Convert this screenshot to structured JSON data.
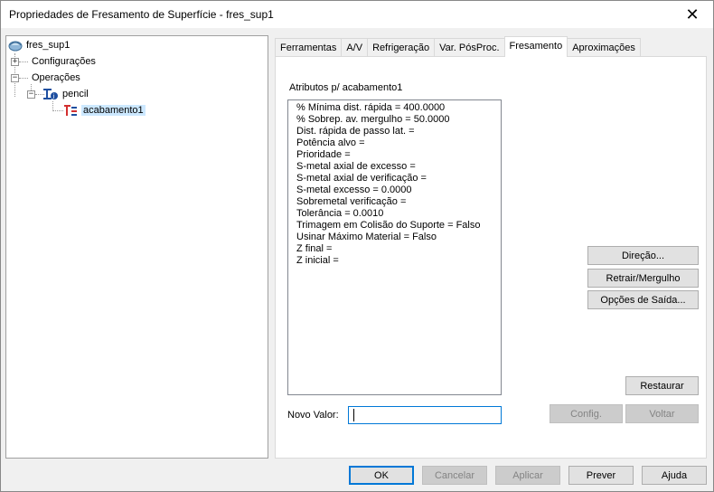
{
  "window": {
    "title": "Propriedades de Fresamento de Superfície - fres_sup1",
    "close_glyph": "✕"
  },
  "tree": {
    "root": "fres_sup1",
    "items": [
      {
        "label": "Configurações",
        "expander": "+"
      },
      {
        "label": "Operações",
        "expander": "−"
      },
      {
        "label": "pencil",
        "expander": "−"
      },
      {
        "label": "acabamento1"
      }
    ]
  },
  "tabs": [
    {
      "label": "Ferramentas"
    },
    {
      "label": "A/V"
    },
    {
      "label": "Refrigeração"
    },
    {
      "label": "Var. PósProc."
    },
    {
      "label": "Fresamento",
      "active": true
    },
    {
      "label": "Aproximações"
    }
  ],
  "attributes": {
    "header": "Atributos p/   acabamento1",
    "items": [
      "% Mínima dist. rápida = 400.0000",
      "% Sobrep. av. mergulho = 50.0000",
      "Dist. rápida de passo lat. =",
      "Potência alvo =",
      "Prioridade =",
      "S-metal axial de excesso =",
      "S-metal axial de verificação =",
      "S-metal excesso = 0.0000",
      "Sobremetal verificação =",
      "Tolerância = 0.0010",
      "Trimagem em Colisão do Suporte = Falso",
      "Usinar Máximo Material = Falso",
      "Z final =",
      "Z inicial ="
    ]
  },
  "side_buttons": {
    "direction": "Direção...",
    "retract": "Retrair/Mergulho",
    "output": "Opções de Saída...",
    "restore": "Restaurar",
    "config": "Config.",
    "back": "Voltar"
  },
  "new_value": {
    "label": "Novo Valor:",
    "value": ""
  },
  "footer": {
    "ok": "OK",
    "cancel": "Cancelar",
    "apply": "Aplicar",
    "preview": "Prever",
    "help": "Ajuda"
  },
  "colors": {
    "accent": "#0078d7",
    "selection": "#cce8ff",
    "op_icon_red": "#d32f2f",
    "op_icon_blue": "#1e4fa0"
  }
}
